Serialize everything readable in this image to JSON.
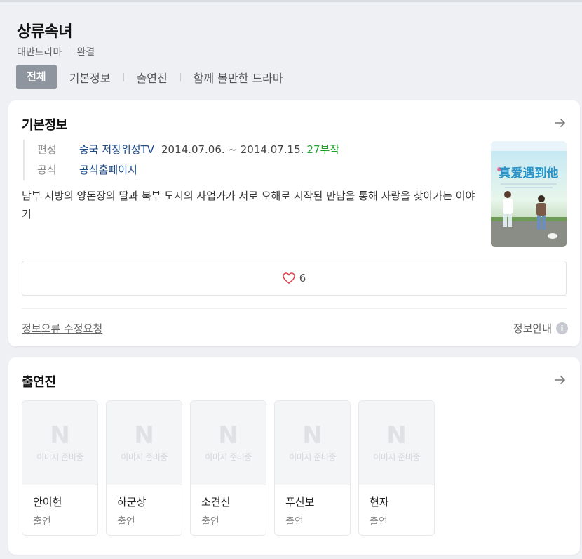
{
  "header": {
    "title": "상류속녀",
    "genre": "대만드라마",
    "status": "완결"
  },
  "tabs": [
    {
      "label": "전체",
      "active": true
    },
    {
      "label": "기본정보",
      "active": false
    },
    {
      "label": "출연진",
      "active": false
    },
    {
      "label": "함께 볼만한 드라마",
      "active": false
    }
  ],
  "basic_info": {
    "title": "기본정보",
    "broadcast_label": "편성",
    "broadcast_channel": "중국 저장위성TV",
    "broadcast_dates": "2014.07.06. ~ 2014.07.15.",
    "episodes": "27부작",
    "official_label": "공식",
    "official_link": "공식홈페이지",
    "description": "남부 지방의 양돈장의 딸과 북부 도시의 사업가가 서로 오해로 시작된 만남을 통해 사랑을 찾아가는 이야기",
    "poster_title": "真爱遇到他",
    "like_count": "6",
    "report_link": "정보오류 수정요청",
    "info_guide": "정보안내"
  },
  "cast_section": {
    "title": "출연진",
    "placeholder_logo": "N",
    "placeholder_text": "이미지 준비중",
    "members": [
      {
        "name": "안이헌",
        "role": "출연"
      },
      {
        "name": "하군상",
        "role": "출연"
      },
      {
        "name": "소견신",
        "role": "출연"
      },
      {
        "name": "푸신보",
        "role": "출연"
      },
      {
        "name": "현자",
        "role": "출연"
      }
    ]
  },
  "colors": {
    "background": "#eef0f4",
    "active_tab": "#8e959f",
    "link_blue": "#1b4a8a",
    "episode_green": "#21a02a",
    "heart": "#e0404a"
  },
  "icons": [
    "arrow-right-icon",
    "heart-icon",
    "info-icon"
  ]
}
